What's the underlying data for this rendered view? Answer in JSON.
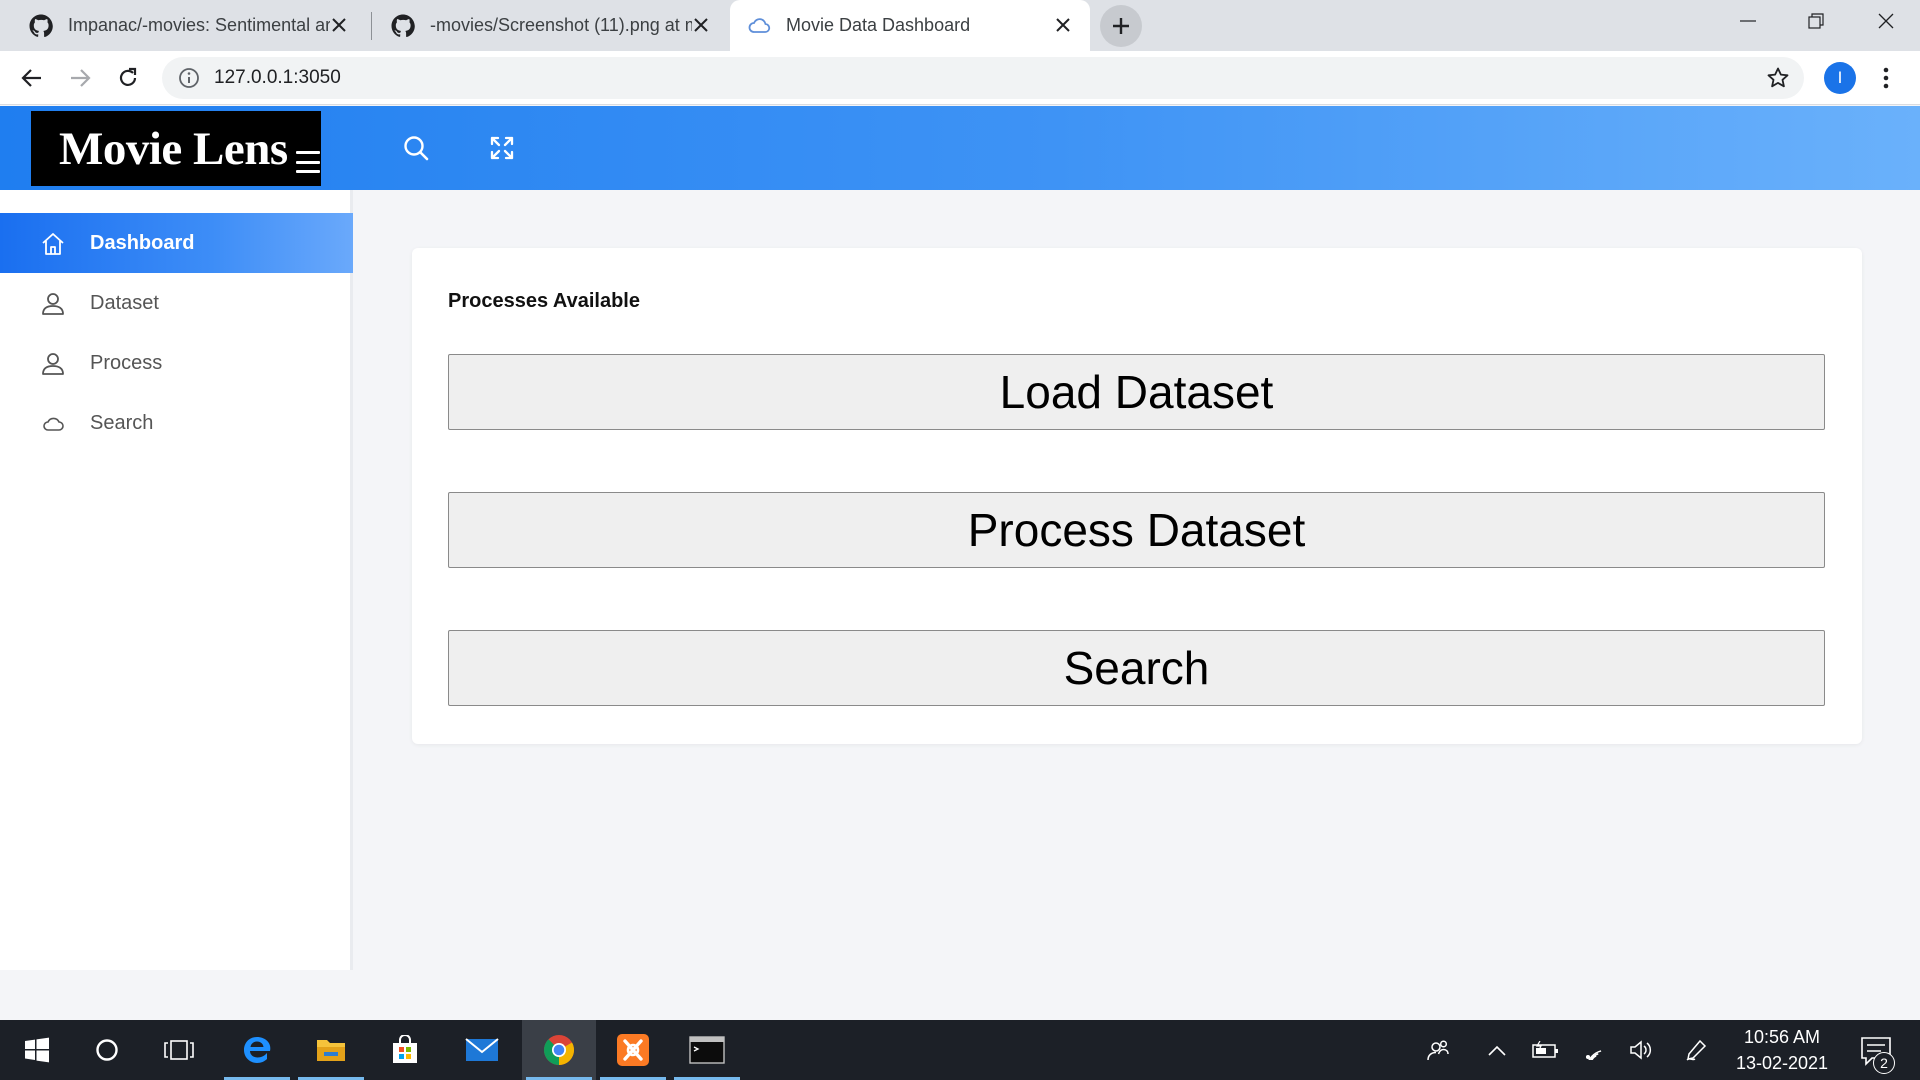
{
  "browser": {
    "tabs": [
      {
        "title": "Impanac/-movies: Sentimental ar",
        "icon": "github-icon",
        "active": false
      },
      {
        "title": "-movies/Screenshot (11).png at m",
        "icon": "github-icon",
        "active": false
      },
      {
        "title": "Movie Data Dashboard",
        "icon": "cloud-icon",
        "active": true
      }
    ],
    "url": "127.0.0.1:3050",
    "profile_initial": "I"
  },
  "header": {
    "brand": "Movie Lens",
    "icons": [
      "menu-icon",
      "search-icon",
      "fullscreen-icon"
    ],
    "colors": {
      "gradient_start": "#1f7ef0",
      "gradient_end": "#6ab1fb",
      "brand_bg": "#000000"
    }
  },
  "sidebar": {
    "items": [
      {
        "label": "Dashboard",
        "icon": "home-icon",
        "active": true
      },
      {
        "label": "Dataset",
        "icon": "user-icon",
        "active": false
      },
      {
        "label": "Process",
        "icon": "user-icon",
        "active": false
      },
      {
        "label": "Search",
        "icon": "cloud-icon",
        "active": false
      }
    ]
  },
  "main": {
    "card_title": "Processes Available",
    "buttons": [
      "Load Dataset",
      "Process Dataset",
      "Search"
    ]
  },
  "taskbar": {
    "apps": [
      "windows-start-icon",
      "cortana-icon",
      "task-view-icon",
      "edge-icon",
      "file-explorer-icon",
      "store-icon",
      "mail-icon",
      "chrome-icon",
      "xampp-icon",
      "terminal-icon"
    ],
    "time": "10:56 AM",
    "date": "13-02-2021",
    "notifications": "2"
  }
}
